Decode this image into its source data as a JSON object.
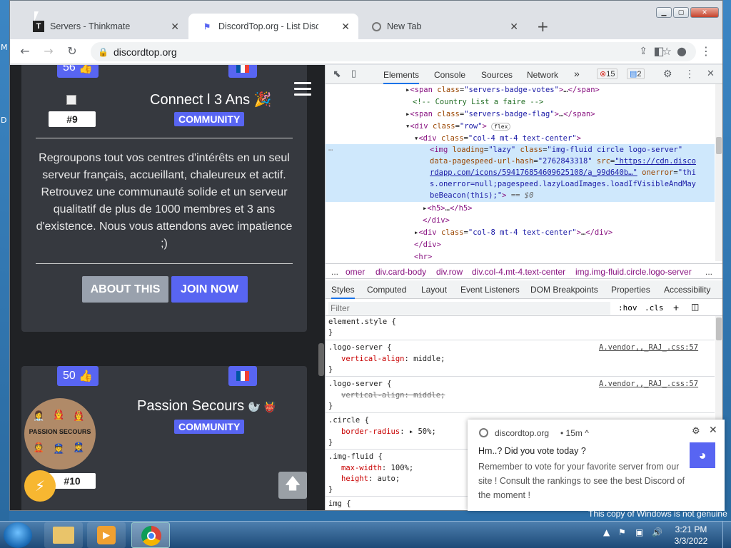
{
  "browser": {
    "tabs": [
      {
        "title": "Servers - Thinkmate",
        "fav": "T"
      },
      {
        "title": "DiscordTop.org - List Discord ser",
        "fav": "⚑"
      },
      {
        "title": "New Tab",
        "fav": ""
      }
    ],
    "url": "discordtop.org"
  },
  "page": {
    "cards": [
      {
        "votes": "56",
        "name": "Connect l 3 Ans 🎉",
        "category": "COMMUNITY",
        "rank": "#9",
        "description": "Regroupons tout vos centres d'intérêts en un seul serveur français, accueillant, chaleureux et actif. Retrouvez une communauté solide et un serveur qualitatif de plus de 1000 membres et 3 ans d'existence. Nous vous attendons avec impatience ;)",
        "about_label": "ABOUT THIS",
        "join_label": "JOIN NOW"
      },
      {
        "votes": "50",
        "name": "Passion Secours",
        "category": "COMMUNITY",
        "rank": "#10",
        "avatar_text": "PASSION SECOURS"
      }
    ]
  },
  "devtools": {
    "tabs": [
      "Elements",
      "Console",
      "Sources",
      "Network"
    ],
    "errors": "15",
    "messages": "2",
    "breadcrumbs": [
      "...",
      "omer",
      "div.card-body",
      "div.row",
      "div.col-4.mt-4.text-center",
      "img.img-fluid.circle.logo-server",
      "..."
    ],
    "style_tabs": [
      "Styles",
      "Computed",
      "Layout",
      "Event Listeners",
      "DOM Breakpoints",
      "Properties",
      "Accessibility"
    ],
    "filter_placeholder": "Filter",
    "hov": ":hov",
    "cls": ".cls",
    "source_a": "A.vendor,,_RAJ_.css:57",
    "source_b": "A.vendor,,_RAJ_.css:57"
  },
  "notification": {
    "site": "discordtop.org",
    "time": "• 15m ^",
    "title": "Hm..? Did you vote today ?",
    "body": "Remember to vote for your favorite server from our site ! Consult the rankings to see the best Discord of the moment !"
  },
  "taskbar": {
    "time": "3:21 PM",
    "date": "3/3/2022",
    "watermark": "This copy of Windows is not genuine"
  }
}
